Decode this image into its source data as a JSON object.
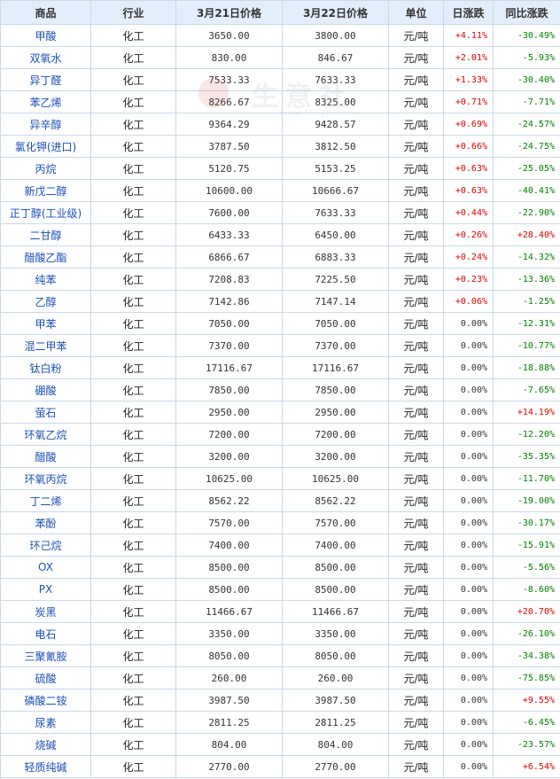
{
  "headers": {
    "name": "商品",
    "industry": "行业",
    "price1": "3月21日价格",
    "price2": "3月22日价格",
    "unit": "单位",
    "daily": "日涨跌",
    "yoy": "同比涨跌"
  },
  "watermark": {
    "text": "生意社",
    "url": "www.100ppi.com"
  },
  "colors": {
    "up": "#e00000",
    "down": "#008000",
    "header_bg": "#e3eefa",
    "border": "#c9d9ea",
    "name_link": "#1a4fb8"
  },
  "rows": [
    {
      "name": "甲酸",
      "industry": "化工",
      "p1": "3650.00",
      "p2": "3800.00",
      "unit": "元/吨",
      "daily": "+4.11%",
      "yoy": "-30.49%"
    },
    {
      "name": "双氧水",
      "industry": "化工",
      "p1": "830.00",
      "p2": "846.67",
      "unit": "元/吨",
      "daily": "+2.01%",
      "yoy": "-5.93%"
    },
    {
      "name": "异丁醛",
      "industry": "化工",
      "p1": "7533.33",
      "p2": "7633.33",
      "unit": "元/吨",
      "daily": "+1.33%",
      "yoy": "-30.40%"
    },
    {
      "name": "苯乙烯",
      "industry": "化工",
      "p1": "8266.67",
      "p2": "8325.00",
      "unit": "元/吨",
      "daily": "+0.71%",
      "yoy": "-7.71%"
    },
    {
      "name": "异辛醇",
      "industry": "化工",
      "p1": "9364.29",
      "p2": "9428.57",
      "unit": "元/吨",
      "daily": "+0.69%",
      "yoy": "-24.57%"
    },
    {
      "name": "氯化钾(进口)",
      "industry": "化工",
      "p1": "3787.50",
      "p2": "3812.50",
      "unit": "元/吨",
      "daily": "+0.66%",
      "yoy": "-24.75%"
    },
    {
      "name": "丙烷",
      "industry": "化工",
      "p1": "5120.75",
      "p2": "5153.25",
      "unit": "元/吨",
      "daily": "+0.63%",
      "yoy": "-25.05%"
    },
    {
      "name": "新戊二醇",
      "industry": "化工",
      "p1": "10600.00",
      "p2": "10666.67",
      "unit": "元/吨",
      "daily": "+0.63%",
      "yoy": "-40.41%"
    },
    {
      "name": "正丁醇(工业级)",
      "industry": "化工",
      "p1": "7600.00",
      "p2": "7633.33",
      "unit": "元/吨",
      "daily": "+0.44%",
      "yoy": "-22.90%"
    },
    {
      "name": "二甘醇",
      "industry": "化工",
      "p1": "6433.33",
      "p2": "6450.00",
      "unit": "元/吨",
      "daily": "+0.26%",
      "yoy": "+28.40%"
    },
    {
      "name": "醋酸乙酯",
      "industry": "化工",
      "p1": "6866.67",
      "p2": "6883.33",
      "unit": "元/吨",
      "daily": "+0.24%",
      "yoy": "-14.32%"
    },
    {
      "name": "纯苯",
      "industry": "化工",
      "p1": "7208.83",
      "p2": "7225.50",
      "unit": "元/吨",
      "daily": "+0.23%",
      "yoy": "-13.36%"
    },
    {
      "name": "乙醇",
      "industry": "化工",
      "p1": "7142.86",
      "p2": "7147.14",
      "unit": "元/吨",
      "daily": "+0.06%",
      "yoy": "-1.25%"
    },
    {
      "name": "甲苯",
      "industry": "化工",
      "p1": "7050.00",
      "p2": "7050.00",
      "unit": "元/吨",
      "daily": "0.00%",
      "yoy": "-12.31%"
    },
    {
      "name": "混二甲苯",
      "industry": "化工",
      "p1": "7370.00",
      "p2": "7370.00",
      "unit": "元/吨",
      "daily": "0.00%",
      "yoy": "-10.77%"
    },
    {
      "name": "钛白粉",
      "industry": "化工",
      "p1": "17116.67",
      "p2": "17116.67",
      "unit": "元/吨",
      "daily": "0.00%",
      "yoy": "-18.88%"
    },
    {
      "name": "硼酸",
      "industry": "化工",
      "p1": "7850.00",
      "p2": "7850.00",
      "unit": "元/吨",
      "daily": "0.00%",
      "yoy": "-7.65%"
    },
    {
      "name": "萤石",
      "industry": "化工",
      "p1": "2950.00",
      "p2": "2950.00",
      "unit": "元/吨",
      "daily": "0.00%",
      "yoy": "+14.19%"
    },
    {
      "name": "环氧乙烷",
      "industry": "化工",
      "p1": "7200.00",
      "p2": "7200.00",
      "unit": "元/吨",
      "daily": "0.00%",
      "yoy": "-12.20%"
    },
    {
      "name": "醋酸",
      "industry": "化工",
      "p1": "3200.00",
      "p2": "3200.00",
      "unit": "元/吨",
      "daily": "0.00%",
      "yoy": "-35.35%"
    },
    {
      "name": "环氧丙烷",
      "industry": "化工",
      "p1": "10625.00",
      "p2": "10625.00",
      "unit": "元/吨",
      "daily": "0.00%",
      "yoy": "-11.70%"
    },
    {
      "name": "丁二烯",
      "industry": "化工",
      "p1": "8562.22",
      "p2": "8562.22",
      "unit": "元/吨",
      "daily": "0.00%",
      "yoy": "-19.00%"
    },
    {
      "name": "苯酚",
      "industry": "化工",
      "p1": "7570.00",
      "p2": "7570.00",
      "unit": "元/吨",
      "daily": "0.00%",
      "yoy": "-30.17%"
    },
    {
      "name": "环己烷",
      "industry": "化工",
      "p1": "7400.00",
      "p2": "7400.00",
      "unit": "元/吨",
      "daily": "0.00%",
      "yoy": "-15.91%"
    },
    {
      "name": "OX",
      "industry": "化工",
      "p1": "8500.00",
      "p2": "8500.00",
      "unit": "元/吨",
      "daily": "0.00%",
      "yoy": "-5.56%"
    },
    {
      "name": "PX",
      "industry": "化工",
      "p1": "8500.00",
      "p2": "8500.00",
      "unit": "元/吨",
      "daily": "0.00%",
      "yoy": "-8.60%"
    },
    {
      "name": "炭黑",
      "industry": "化工",
      "p1": "11466.67",
      "p2": "11466.67",
      "unit": "元/吨",
      "daily": "0.00%",
      "yoy": "+20.70%"
    },
    {
      "name": "电石",
      "industry": "化工",
      "p1": "3350.00",
      "p2": "3350.00",
      "unit": "元/吨",
      "daily": "0.00%",
      "yoy": "-26.10%"
    },
    {
      "name": "三聚氰胺",
      "industry": "化工",
      "p1": "8050.00",
      "p2": "8050.00",
      "unit": "元/吨",
      "daily": "0.00%",
      "yoy": "-34.38%"
    },
    {
      "name": "硫酸",
      "industry": "化工",
      "p1": "260.00",
      "p2": "260.00",
      "unit": "元/吨",
      "daily": "0.00%",
      "yoy": "-75.85%"
    },
    {
      "name": "磷酸二铵",
      "industry": "化工",
      "p1": "3987.50",
      "p2": "3987.50",
      "unit": "元/吨",
      "daily": "0.00%",
      "yoy": "+9.55%"
    },
    {
      "name": "尿素",
      "industry": "化工",
      "p1": "2811.25",
      "p2": "2811.25",
      "unit": "元/吨",
      "daily": "0.00%",
      "yoy": "-6.45%"
    },
    {
      "name": "烧碱",
      "industry": "化工",
      "p1": "804.00",
      "p2": "804.00",
      "unit": "元/吨",
      "daily": "0.00%",
      "yoy": "-23.57%"
    },
    {
      "name": "轻质纯碱",
      "industry": "化工",
      "p1": "2770.00",
      "p2": "2770.00",
      "unit": "元/吨",
      "daily": "0.00%",
      "yoy": "+6.54%"
    }
  ]
}
